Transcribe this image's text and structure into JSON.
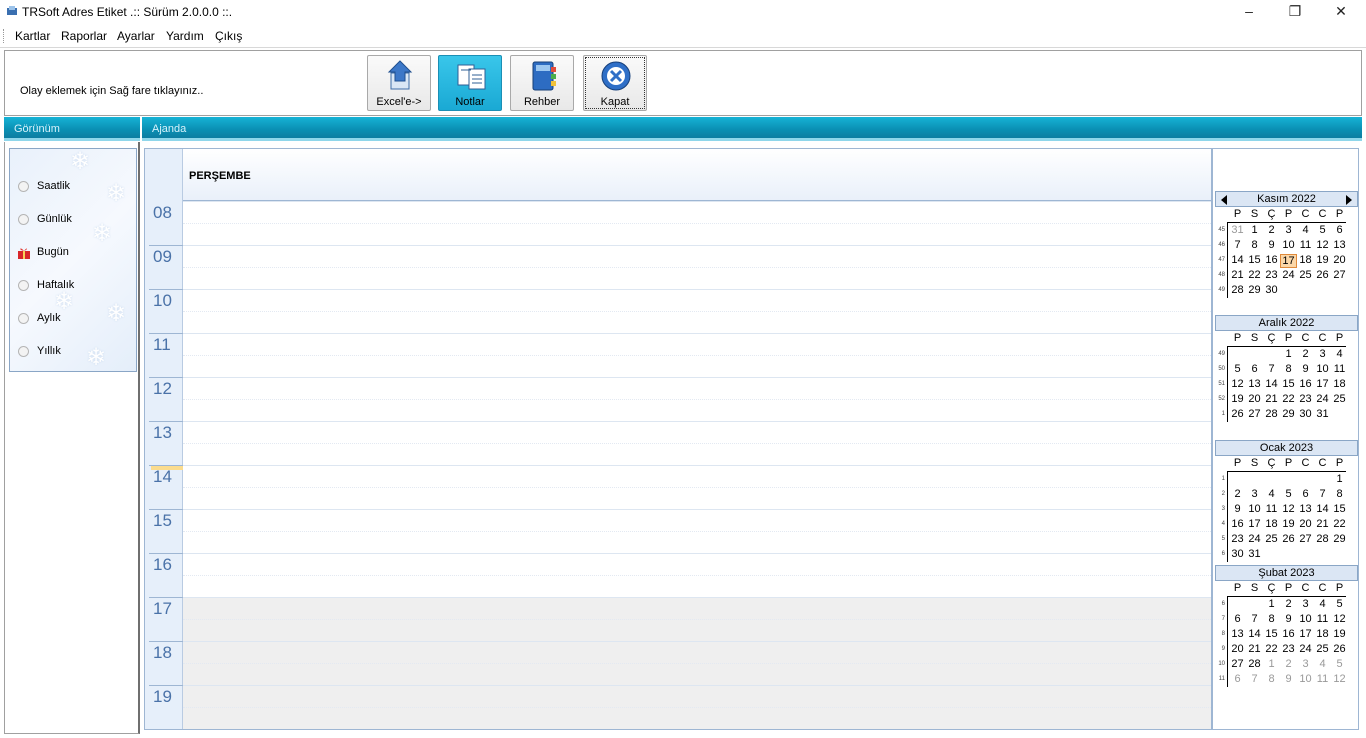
{
  "titlebar": {
    "title": "TRSoft Adres Etiket  .:: Sürüm 2.0.0.0 ::.",
    "minimize": "–",
    "restore": "❐",
    "close": "✕"
  },
  "menu": [
    "Kartlar",
    "Raporlar",
    "Ayarlar",
    "Yardım",
    "Çıkış"
  ],
  "toolbar": {
    "hint": "Olay eklemek için Sağ fare tıklayınız..",
    "buttons": [
      {
        "label": "Excel'e->",
        "icon": "export-icon"
      },
      {
        "label": "Notlar",
        "icon": "notes-icon"
      },
      {
        "label": "Rehber",
        "icon": "addressbook-icon"
      },
      {
        "label": "Kapat",
        "icon": "close-circle-icon"
      }
    ]
  },
  "left": {
    "header": "Görünüm",
    "views": [
      "Saatlik",
      "Günlük",
      "Bugün",
      "Haftalık",
      "Aylık",
      "Yıllık"
    ],
    "selected": "Bugün"
  },
  "agenda": {
    "header": "Ajanda",
    "day": "PERŞEMBE",
    "hours": [
      "08",
      "09",
      "10",
      "11",
      "12",
      "13",
      "14",
      "15",
      "16",
      "17",
      "18",
      "19"
    ]
  },
  "calendar": {
    "dow": [
      "P",
      "S",
      "Ç",
      "P",
      "C",
      "C",
      "P"
    ],
    "months": [
      {
        "title": "Kasım 2022",
        "weeks": [
          "45",
          "46",
          "47",
          "48",
          "49"
        ],
        "rows": [
          [
            "31",
            "1",
            "2",
            "3",
            "4",
            "5",
            "6"
          ],
          [
            "7",
            "8",
            "9",
            "10",
            "11",
            "12",
            "13"
          ],
          [
            "14",
            "15",
            "16",
            "17",
            "18",
            "19",
            "20"
          ],
          [
            "21",
            "22",
            "23",
            "24",
            "25",
            "26",
            "27"
          ],
          [
            "28",
            "29",
            "30",
            "",
            "",
            "",
            ""
          ]
        ],
        "other": [
          [
            0,
            0
          ]
        ],
        "today": [
          2,
          3
        ]
      },
      {
        "title": "Aralık 2022",
        "weeks": [
          "49",
          "50",
          "51",
          "52",
          "1"
        ],
        "rows": [
          [
            "",
            "",
            "",
            "1",
            "2",
            "3",
            "4"
          ],
          [
            "5",
            "6",
            "7",
            "8",
            "9",
            "10",
            "11"
          ],
          [
            "12",
            "13",
            "14",
            "15",
            "16",
            "17",
            "18"
          ],
          [
            "19",
            "20",
            "21",
            "22",
            "23",
            "24",
            "25"
          ],
          [
            "26",
            "27",
            "28",
            "29",
            "30",
            "31",
            ""
          ]
        ],
        "other": []
      },
      {
        "title": "Ocak 2023",
        "weeks": [
          "1",
          "2",
          "3",
          "4",
          "5",
          "6"
        ],
        "rows": [
          [
            "",
            "",
            "",
            "",
            "",
            "",
            "1"
          ],
          [
            "2",
            "3",
            "4",
            "5",
            "6",
            "7",
            "8"
          ],
          [
            "9",
            "10",
            "11",
            "12",
            "13",
            "14",
            "15"
          ],
          [
            "16",
            "17",
            "18",
            "19",
            "20",
            "21",
            "22"
          ],
          [
            "23",
            "24",
            "25",
            "26",
            "27",
            "28",
            "29"
          ],
          [
            "30",
            "31",
            "",
            "",
            "",
            "",
            ""
          ]
        ],
        "other": []
      },
      {
        "title": "Şubat 2023",
        "weeks": [
          "6",
          "7",
          "8",
          "9",
          "10",
          "11"
        ],
        "rows": [
          [
            "",
            "",
            "1",
            "2",
            "3",
            "4",
            "5"
          ],
          [
            "6",
            "7",
            "8",
            "9",
            "10",
            "11",
            "12"
          ],
          [
            "13",
            "14",
            "15",
            "16",
            "17",
            "18",
            "19"
          ],
          [
            "20",
            "21",
            "22",
            "23",
            "24",
            "25",
            "26"
          ],
          [
            "27",
            "28",
            "1",
            "2",
            "3",
            "4",
            "5"
          ],
          [
            "6",
            "7",
            "8",
            "9",
            "10",
            "11",
            "12"
          ]
        ],
        "other": [
          [
            4,
            2
          ],
          [
            4,
            3
          ],
          [
            4,
            4
          ],
          [
            4,
            5
          ],
          [
            4,
            6
          ],
          [
            5,
            0
          ],
          [
            5,
            1
          ],
          [
            5,
            2
          ],
          [
            5,
            3
          ],
          [
            5,
            4
          ],
          [
            5,
            5
          ],
          [
            5,
            6
          ]
        ]
      }
    ]
  }
}
